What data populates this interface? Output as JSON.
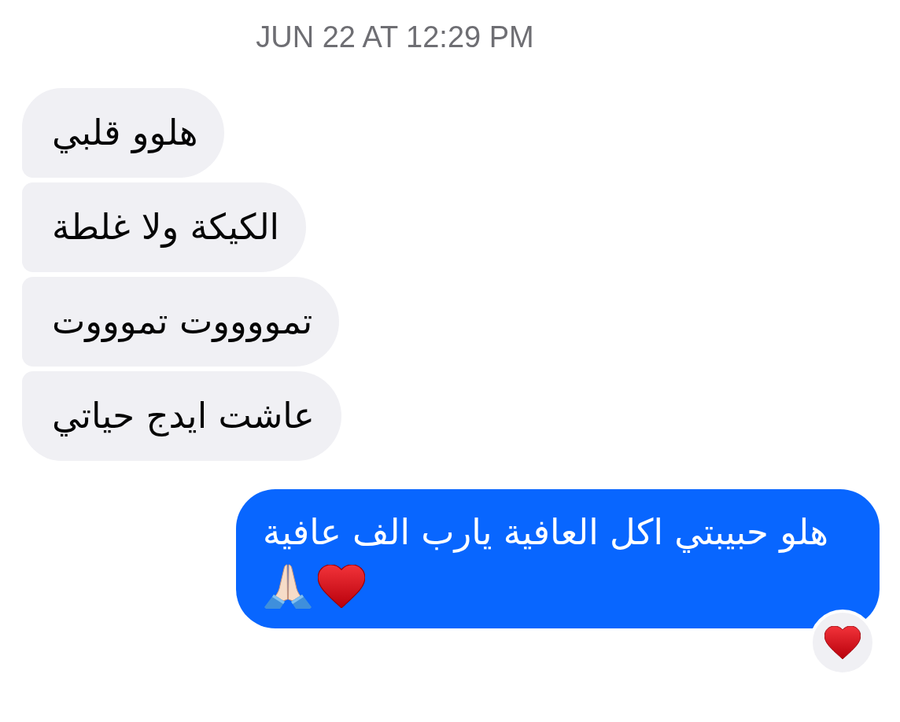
{
  "timestamp": "JUN 22 AT 12:29 PM",
  "messages": [
    {
      "kind": "received",
      "text": "هلوو قلبي"
    },
    {
      "kind": "received",
      "text": "الكيكة ولا غلطة"
    },
    {
      "kind": "received",
      "text": "تمووووت تموووت"
    },
    {
      "kind": "received",
      "text": "عاشت ايدج حياتي"
    },
    {
      "kind": "sent",
      "text": "هلو حبيبتي اكل العافية يارب الف عافية",
      "emojis": [
        {
          "kind": "heart"
        },
        {
          "kind": "praying_hands"
        }
      ],
      "reaction": {
        "kind": "heart"
      }
    }
  ]
}
